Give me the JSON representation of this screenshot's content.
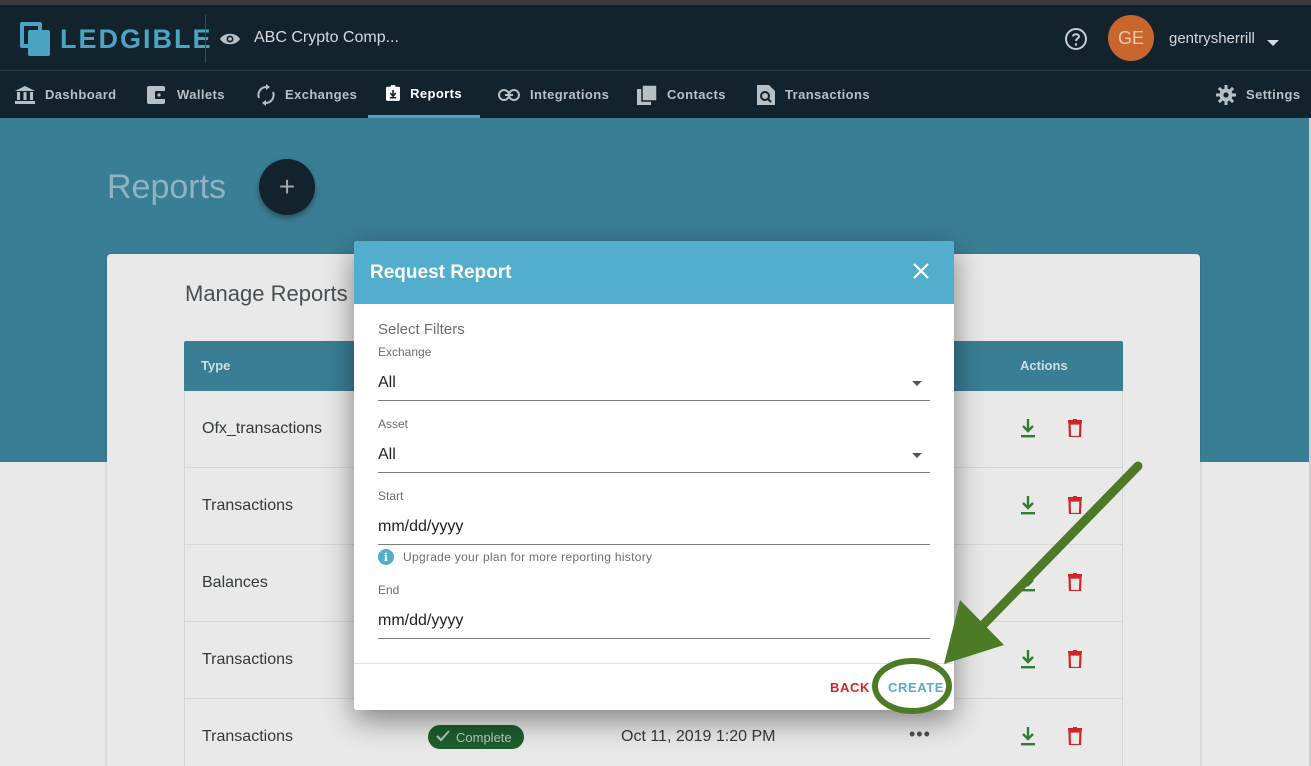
{
  "header": {
    "logo_text": "LEDGIBLE",
    "company": "ABC Crypto Comp...",
    "avatar_initials": "GE",
    "username": "gentrysherrill"
  },
  "nav": {
    "items": [
      {
        "label": "Dashboard",
        "icon": "bank-icon"
      },
      {
        "label": "Wallets",
        "icon": "wallet-icon"
      },
      {
        "label": "Exchanges",
        "icon": "sync-icon"
      },
      {
        "label": "Reports",
        "icon": "report-icon",
        "active": true
      },
      {
        "label": "Integrations",
        "icon": "link-icon"
      },
      {
        "label": "Contacts",
        "icon": "contacts-icon"
      },
      {
        "label": "Transactions",
        "icon": "transactions-icon"
      }
    ],
    "settings_label": "Settings"
  },
  "page": {
    "title": "Reports",
    "add_label": "+"
  },
  "manage": {
    "title": "Manage Reports",
    "columns": {
      "type": "Type",
      "actions": "Actions"
    },
    "rows": [
      {
        "type": "Ofx_transactions"
      },
      {
        "type": "Transactions"
      },
      {
        "type": "Balances"
      },
      {
        "type": "Transactions"
      },
      {
        "type": "Transactions",
        "status": "Complete",
        "date": "Oct 11, 2019 1:20 PM",
        "more": "•••"
      }
    ]
  },
  "modal": {
    "title": "Request Report",
    "filters_label": "Select Filters",
    "exchange": {
      "label": "Exchange",
      "value": "All"
    },
    "asset": {
      "label": "Asset",
      "value": "All"
    },
    "start": {
      "label": "Start",
      "placeholder": "mm/dd/yyyy"
    },
    "hint": "Upgrade your plan for more reporting history",
    "end": {
      "label": "End",
      "placeholder": "mm/dd/yyyy"
    },
    "back_label": "BACK",
    "create_label": "CREATE"
  },
  "colors": {
    "topbar": "#13232d",
    "accent": "#53aecd",
    "hero": "#3a7e95",
    "danger": "#d0262b",
    "success": "#2e7d32",
    "annotation": "#4c7a25"
  }
}
